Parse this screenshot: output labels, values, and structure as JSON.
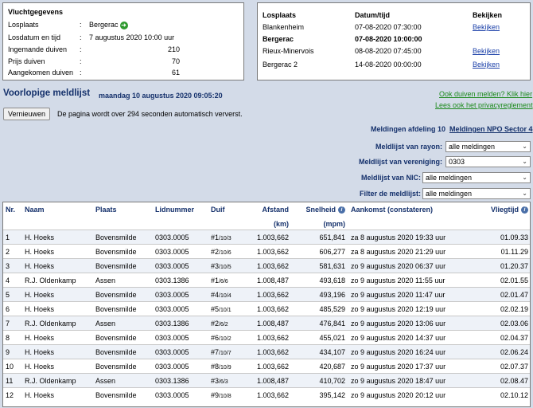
{
  "flight": {
    "title": "Vluchtgegevens",
    "rows": [
      {
        "label": "Losplaats",
        "value": "Bergerac"
      },
      {
        "label": "Losdatum en tijd",
        "value": "7 augustus 2020 10:00 uur"
      },
      {
        "label": "Ingemande duiven",
        "value": "210"
      },
      {
        "label": "Prijs duiven",
        "value": "70"
      },
      {
        "label": "Aangekomen duiven",
        "value": "61"
      }
    ],
    "colon": ":",
    "icon": "forward-arrow-icon"
  },
  "releases": {
    "headers": {
      "location": "Losplaats",
      "datetime": "Datum/tijd",
      "view": "Bekijken"
    },
    "rows": [
      {
        "location": "Blankenheim",
        "datetime": "07-08-2020 07:30:00",
        "view": "Bekijken",
        "bold": false
      },
      {
        "location": "Bergerac",
        "datetime": "07-08-2020 10:00:00",
        "view": "",
        "bold": true
      },
      {
        "location": "Rieux-Minervois",
        "datetime": "08-08-2020 07:45:00",
        "view": "Bekijken",
        "bold": false
      },
      {
        "location": "Bergerac 2",
        "datetime": "14-08-2020 00:00:00",
        "view": "Bekijken",
        "bold": false
      }
    ]
  },
  "header": {
    "title": "Voorlopige meldlijst",
    "subtitle": "maandag 10 augustus 2020 09:05:20",
    "link_report": "Ook duiven melden? Klik hier",
    "link_privacy": "Lees ook het privacyreglement"
  },
  "refresh": {
    "button": "Vernieuwen",
    "text": "De pagina wordt over 294 seconden automatisch ververst."
  },
  "meldingen": {
    "afdeling": "Meldingen afdeling 10",
    "npo": "Meldingen NPO Sector 4"
  },
  "filters": [
    {
      "label": "Meldlijst van rayon:",
      "value": "alle meldingen"
    },
    {
      "label": "Meldlijst van vereniging:",
      "value": "0303"
    },
    {
      "label": "Meldlijst van NIC:",
      "value": "alle meldingen"
    },
    {
      "label": "Filter de meldlijst:",
      "value": "alle meldingen"
    }
  ],
  "table": {
    "headers": {
      "nr": "Nr.",
      "naam": "Naam",
      "plaats": "Plaats",
      "lidnummer": "Lidnummer",
      "duif": "Duif",
      "afstand": "Afstand",
      "afstand_unit": "(km)",
      "snelheid": "Snelheid",
      "snelheid_unit": "(mpm)",
      "aankomst": "Aankomst (constateren)",
      "vliegtijd": "Vliegtijd"
    },
    "rows": [
      {
        "nr": "1",
        "naam": "H. Hoeks",
        "plaats": "Bovensmilde",
        "lid": "0303.0005",
        "duif": "#1",
        "duif_sub": "/10/3",
        "afstand": "1.003,662",
        "snelheid": "651,841",
        "aankomst": "za 8 augustus 2020 19:33 uur",
        "vliegtijd": "01.09.33"
      },
      {
        "nr": "2",
        "naam": "H. Hoeks",
        "plaats": "Bovensmilde",
        "lid": "0303.0005",
        "duif": "#2",
        "duif_sub": "/10/6",
        "afstand": "1.003,662",
        "snelheid": "606,277",
        "aankomst": "za 8 augustus 2020 21:29 uur",
        "vliegtijd": "01.11.29"
      },
      {
        "nr": "3",
        "naam": "H. Hoeks",
        "plaats": "Bovensmilde",
        "lid": "0303.0005",
        "duif": "#3",
        "duif_sub": "/10/5",
        "afstand": "1.003,662",
        "snelheid": "581,631",
        "aankomst": "zo 9 augustus 2020 06:37 uur",
        "vliegtijd": "01.20.37"
      },
      {
        "nr": "4",
        "naam": "R.J. Oldenkamp",
        "plaats": "Assen",
        "lid": "0303.1386",
        "duif": "#1",
        "duif_sub": "/6/6",
        "afstand": "1.008,487",
        "snelheid": "493,618",
        "aankomst": "zo 9 augustus 2020 11:55 uur",
        "vliegtijd": "02.01.55"
      },
      {
        "nr": "5",
        "naam": "H. Hoeks",
        "plaats": "Bovensmilde",
        "lid": "0303.0005",
        "duif": "#4",
        "duif_sub": "/10/4",
        "afstand": "1.003,662",
        "snelheid": "493,196",
        "aankomst": "zo 9 augustus 2020 11:47 uur",
        "vliegtijd": "02.01.47"
      },
      {
        "nr": "6",
        "naam": "H. Hoeks",
        "plaats": "Bovensmilde",
        "lid": "0303.0005",
        "duif": "#5",
        "duif_sub": "/10/1",
        "afstand": "1.003,662",
        "snelheid": "485,529",
        "aankomst": "zo 9 augustus 2020 12:19 uur",
        "vliegtijd": "02.02.19"
      },
      {
        "nr": "7",
        "naam": "R.J. Oldenkamp",
        "plaats": "Assen",
        "lid": "0303.1386",
        "duif": "#2",
        "duif_sub": "/6/2",
        "afstand": "1.008,487",
        "snelheid": "476,841",
        "aankomst": "zo 9 augustus 2020 13:06 uur",
        "vliegtijd": "02.03.06"
      },
      {
        "nr": "8",
        "naam": "H. Hoeks",
        "plaats": "Bovensmilde",
        "lid": "0303.0005",
        "duif": "#6",
        "duif_sub": "/10/2",
        "afstand": "1.003,662",
        "snelheid": "455,021",
        "aankomst": "zo 9 augustus 2020 14:37 uur",
        "vliegtijd": "02.04.37"
      },
      {
        "nr": "9",
        "naam": "H. Hoeks",
        "plaats": "Bovensmilde",
        "lid": "0303.0005",
        "duif": "#7",
        "duif_sub": "/10/7",
        "afstand": "1.003,662",
        "snelheid": "434,107",
        "aankomst": "zo 9 augustus 2020 16:24 uur",
        "vliegtijd": "02.06.24"
      },
      {
        "nr": "10",
        "naam": "H. Hoeks",
        "plaats": "Bovensmilde",
        "lid": "0303.0005",
        "duif": "#8",
        "duif_sub": "/10/9",
        "afstand": "1.003,662",
        "snelheid": "420,687",
        "aankomst": "zo 9 augustus 2020 17:37 uur",
        "vliegtijd": "02.07.37"
      },
      {
        "nr": "11",
        "naam": "R.J. Oldenkamp",
        "plaats": "Assen",
        "lid": "0303.1386",
        "duif": "#3",
        "duif_sub": "/6/3",
        "afstand": "1.008,487",
        "snelheid": "410,702",
        "aankomst": "zo 9 augustus 2020 18:47 uur",
        "vliegtijd": "02.08.47"
      },
      {
        "nr": "12",
        "naam": "H. Hoeks",
        "plaats": "Bovensmilde",
        "lid": "0303.0005",
        "duif": "#9",
        "duif_sub": "/10/8",
        "afstand": "1.003,662",
        "snelheid": "395,142",
        "aankomst": "zo 9 augustus 2020 20:12 uur",
        "vliegtijd": "02.10.12"
      }
    ]
  },
  "colors": {
    "background": "#d3dbe8",
    "heading": "#14306b",
    "link": "#1a3fa8",
    "green_link": "#1d8a1d"
  }
}
